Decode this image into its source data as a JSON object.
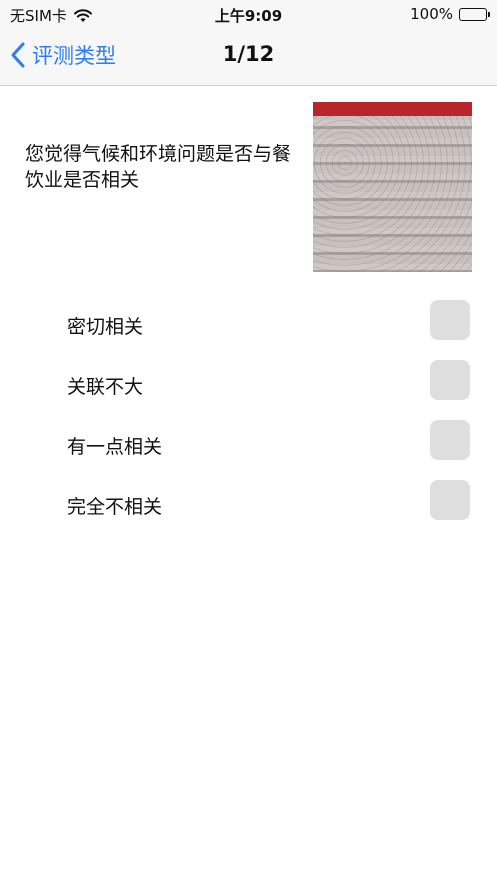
{
  "status_bar": {
    "carrier": "无SIM卡",
    "time": "上午9:09",
    "battery": "100%"
  },
  "nav": {
    "back_label": "评测类型",
    "title": "1/12"
  },
  "question": {
    "text": "您觉得气候和环境问题是否与餐饮业是否相关"
  },
  "options": [
    {
      "label": "密切相关",
      "checked": false
    },
    {
      "label": "关联不大",
      "checked": false
    },
    {
      "label": "有一点相关",
      "checked": false
    },
    {
      "label": "完全不相关",
      "checked": false
    }
  ],
  "colors": {
    "accent": "#2b7cf6",
    "checkbox": "#dedede",
    "bar_background": "#f7f7f7"
  }
}
